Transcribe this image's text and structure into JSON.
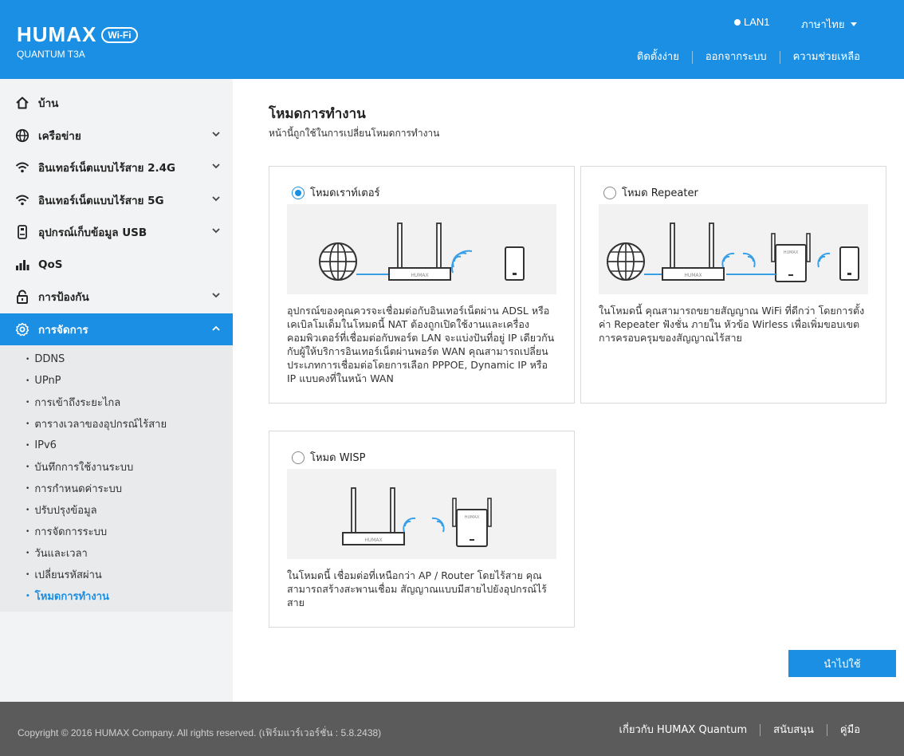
{
  "header": {
    "brand": "HUMAX",
    "badge": "Wi-Fi",
    "model": "QUANTUM T3A",
    "lan_status": "LAN1",
    "language": "ภาษาไทย",
    "nav": [
      "ติดตั้งง่าย",
      "ออกจากระบบ",
      "ความช่วยเหลือ"
    ]
  },
  "sidebar": {
    "items": [
      {
        "label": "บ้าน",
        "icon": "home-icon"
      },
      {
        "label": "เครือข่าย",
        "icon": "globe-icon"
      },
      {
        "label": "อินเทอร์เน็ตแบบไร้สาย 2.4G",
        "icon": "wifi-icon"
      },
      {
        "label": "อินเทอร์เน็ตแบบไร้สาย 5G",
        "icon": "wifi-icon"
      },
      {
        "label": "อุปกรณ์เก็บข้อมูล USB",
        "icon": "usb-icon"
      },
      {
        "label": "QoS",
        "icon": "bars-icon"
      },
      {
        "label": "การป้องกัน",
        "icon": "lock-icon"
      },
      {
        "label": "การจัดการ",
        "icon": "gear-icon"
      }
    ],
    "submenu": [
      "DDNS",
      "UPnP",
      "การเข้าถึงระยะไกล",
      "ตารางเวลาของอุปกรณ์ไร้สาย",
      "IPv6",
      "บันทึกการใช้งานระบบ",
      "การกำหนดค่าระบบ",
      "ปรับปรุงข้อมูล",
      "การจัดการระบบ",
      "วันและเวลา",
      "เปลี่ยนรหัสผ่าน",
      "โหมดการทำงาน"
    ]
  },
  "main": {
    "title": "โหมดการทำงาน",
    "description": "หน้านี้ถูกใช้ในการเปลี่ยนโหมดการทำงาน",
    "modes": [
      {
        "label": "โหมดเราท์เตอร์",
        "selected": true,
        "text": "อุปกรณ์ของคุณควรจะเชื่อมต่อกับอินเทอร์เน็ตผ่าน ADSL หรือเคเบิลโมเด็มในโหมดนี้ NAT ต้องถูกเปิดใช้งานและเครื่องคอมพิวเตอร์ที่เชื่อมต่อกับพอร์ต LAN จะแบ่งปันที่อยู่ IP เดียวกันกับผู้ให้บริการอินเทอร์เน็ตผ่านพอร์ต WAN คุณสามารถเปลี่ยนประเภทการเชื่อมต่อโดยการเลือก PPPOE, Dynamic IP หรือ IP แบบคงที่ในหน้า WAN"
      },
      {
        "label": "โหมด Repeater",
        "selected": false,
        "text": "ในโหมดนี้ คุณสามารถขยายสัญญาณ WiFi ที่ดีกว่า โดยการตั้งค่า Repeater ฟังชั่น ภายใน หัวข้อ Wirless เพื่อเพิ่มขอบเขตการครอบครุมของสัญญาณไร้สาย"
      },
      {
        "label": "โหมด WISP",
        "selected": false,
        "text": "ในโหมดนี้ เชื่อมต่อที่เหนือกว่า AP / Router โดยไร้สาย คุณสามารถสร้างสะพานเชื่อม สัญญาณแบบมีสายไปยังอุปกรณ์ไร้สาย"
      }
    ],
    "device_label": "HUMAX",
    "apply_label": "นำไปใช้"
  },
  "footer": {
    "copyright": "Copyright © 2016 HUMAX Company. All rights reserved. (เฟิร์มแวร์เวอร์ชั่น : 5.8.2438)",
    "links": [
      "เกี่ยวกับ HUMAX Quantum",
      "สนับสนุน",
      "คู่มือ"
    ]
  },
  "colors": {
    "accent": "#1a8fe3",
    "footer": "#5b5b5b",
    "sidebar": "#f2f3f4"
  }
}
